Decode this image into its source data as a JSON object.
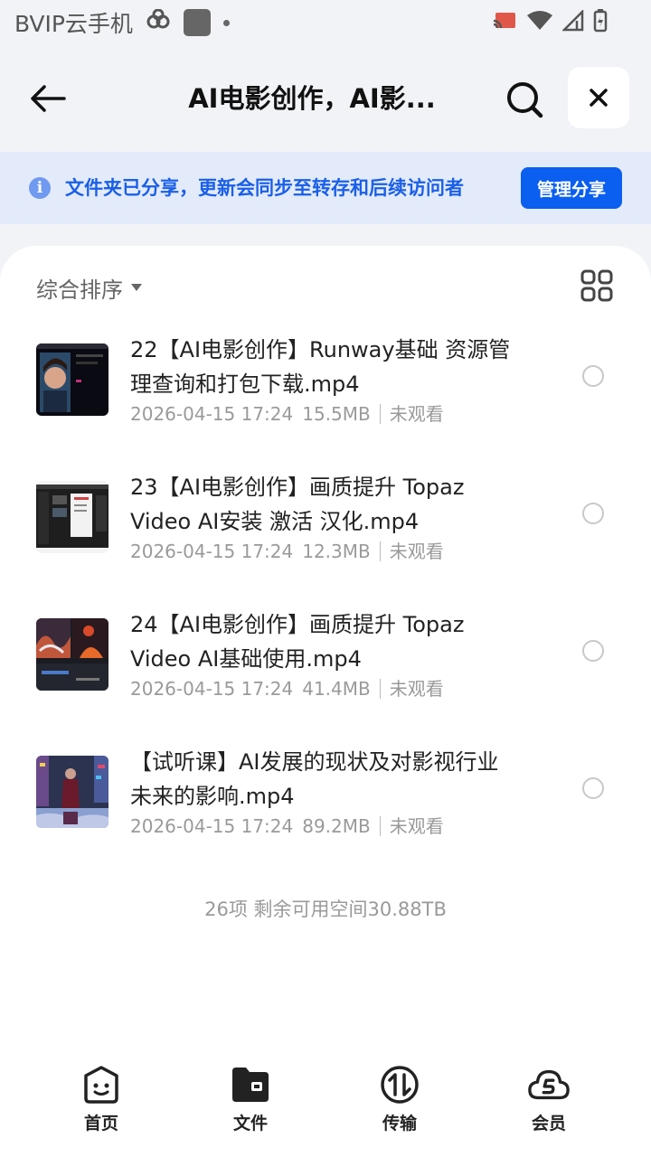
{
  "status_bar": {
    "carrier": "BVIP云手机"
  },
  "header": {
    "title": "AI电影创作，AI影...",
    "back_icon": "back-arrow-icon",
    "search_icon": "search-icon",
    "close_icon": "close-icon"
  },
  "banner": {
    "text": "文件夹已分享，更新会同步至转存和后续访问者",
    "button_label": "管理分享",
    "accent": "#0b5ff0"
  },
  "sort": {
    "label": "综合排序"
  },
  "files": [
    {
      "name": "22【AI电影创作】Runway基础 资源管理查询和打包下载.mp4",
      "date": "2026-04-15 17:24",
      "size": "15.5MB",
      "status": "未观看"
    },
    {
      "name": "23【AI电影创作】画质提升 Topaz Video AI安装 激活 汉化.mp4",
      "date": "2026-04-15 17:24",
      "size": "12.3MB",
      "status": "未观看"
    },
    {
      "name": "24【AI电影创作】画质提升 Topaz Video AI基础使用.mp4",
      "date": "2026-04-15 17:24",
      "size": "41.4MB",
      "status": "未观看"
    },
    {
      "name": "【试听课】AI发展的现状及对影视行业未来的影响.mp4",
      "date": "2026-04-15 17:24",
      "size": "89.2MB",
      "status": "未观看"
    }
  ],
  "summary": "26项 剩余可用空间30.88TB",
  "bottom_nav": [
    {
      "label": "首页",
      "icon": "home-face-icon"
    },
    {
      "label": "文件",
      "icon": "folder-icon"
    },
    {
      "label": "传输",
      "icon": "transfer-icon"
    },
    {
      "label": "会员",
      "icon": "vip-cloud-icon"
    }
  ]
}
